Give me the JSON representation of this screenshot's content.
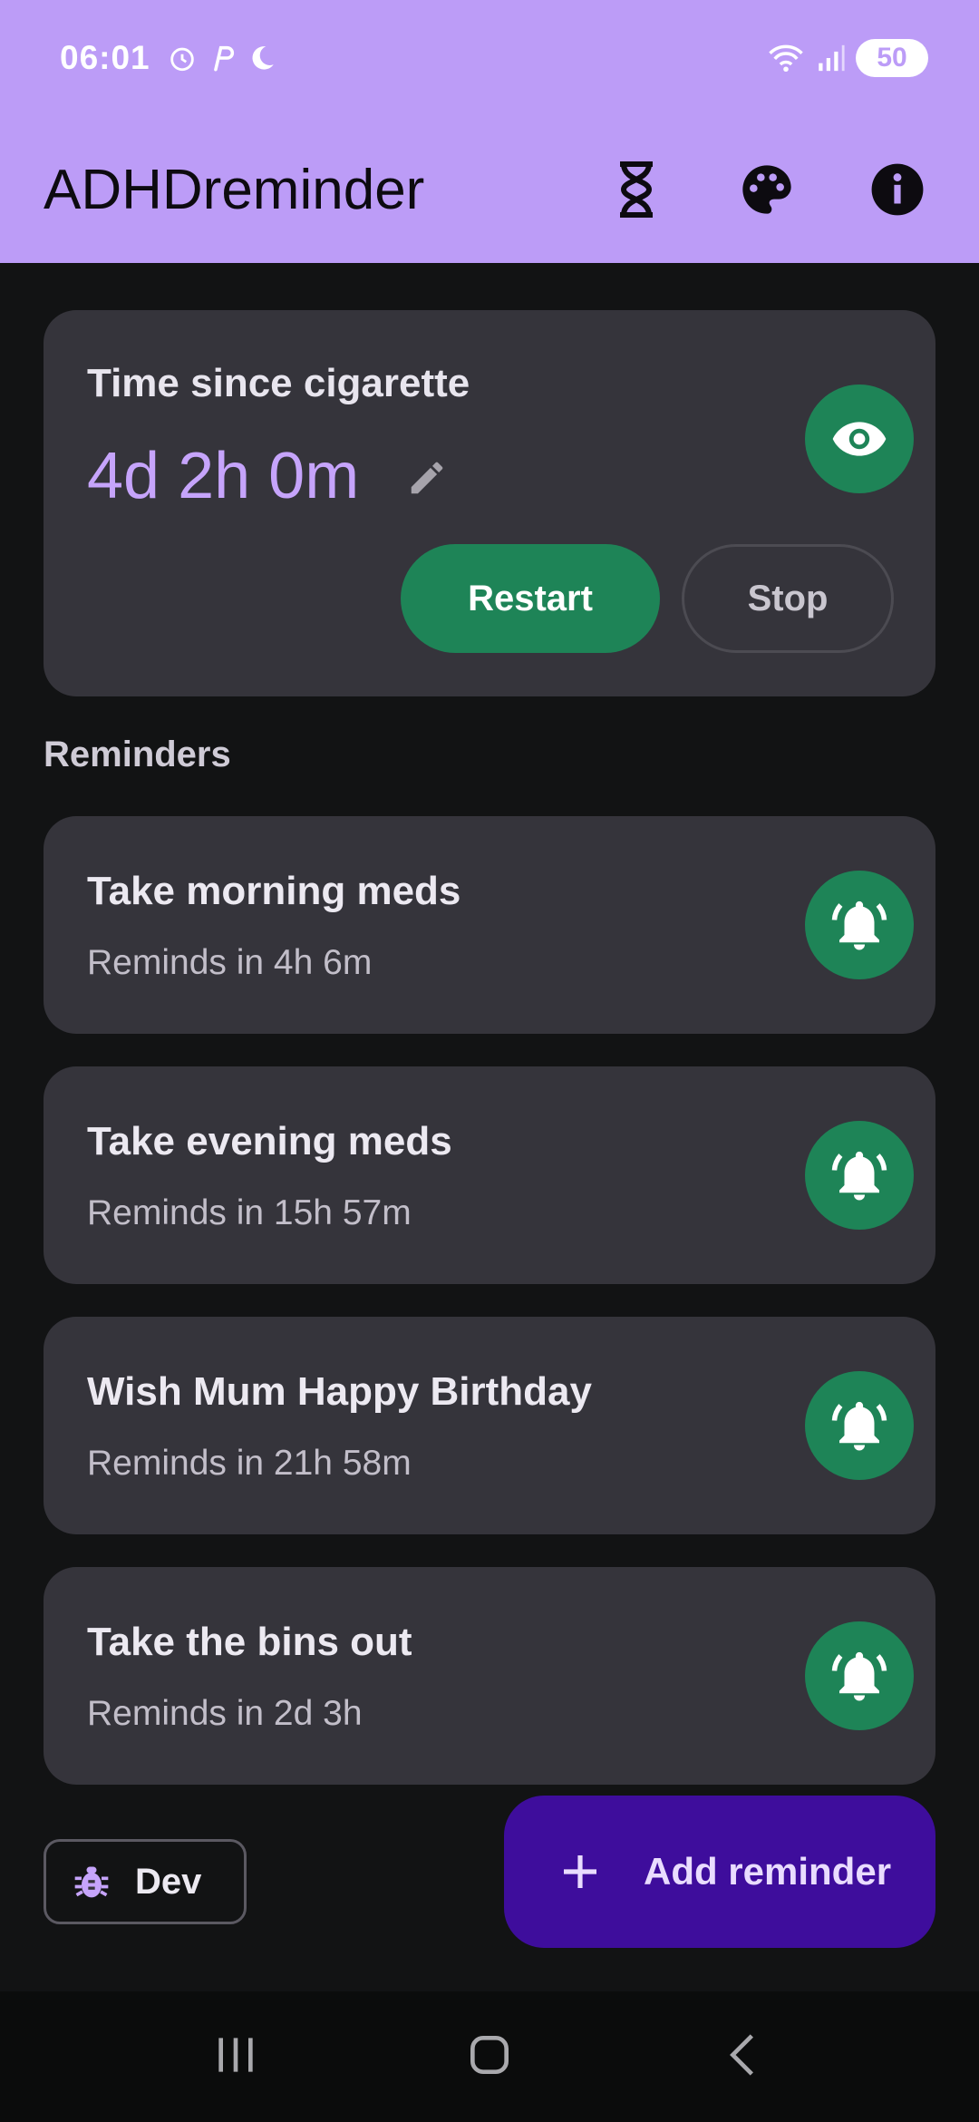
{
  "status_bar": {
    "time": "06:01",
    "battery": "50"
  },
  "app_bar": {
    "title": "ADHDreminder",
    "actions": [
      "hourglass-icon",
      "palette-icon",
      "info-icon"
    ]
  },
  "timer": {
    "title": "Time since cigarette",
    "value": "4d 2h 0m",
    "restart_label": "Restart",
    "stop_label": "Stop"
  },
  "reminders_section": {
    "label": "Reminders",
    "items": [
      {
        "title": "Take morning meds",
        "subtitle": "Reminds in 4h 6m"
      },
      {
        "title": "Take evening meds",
        "subtitle": "Reminds in 15h 57m"
      },
      {
        "title": "Wish Mum Happy Birthday",
        "subtitle": "Reminds in 21h 58m"
      },
      {
        "title": "Take the bins out",
        "subtitle": "Reminds in 2d 3h"
      }
    ]
  },
  "dev_button": {
    "label": "Dev"
  },
  "fab": {
    "label": "Add reminder"
  },
  "colors": {
    "app_bar": "#bc9cf7",
    "accent_green": "#1e8457",
    "card": "#35343b",
    "fab": "#3e0d9c",
    "timer_value": "#c6a4fb"
  }
}
